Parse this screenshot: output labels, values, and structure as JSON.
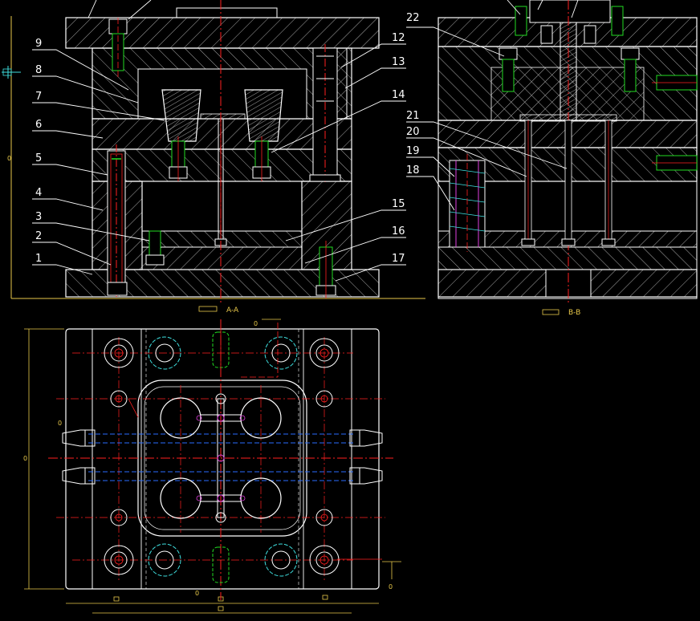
{
  "drawing": {
    "section_aa_caption": "A-A",
    "section_bb_caption": "B-B",
    "dimension_placeholder": "0",
    "part_labels_aa": [
      "9",
      "8",
      "7",
      "6",
      "5",
      "4",
      "3",
      "2",
      "1",
      "12",
      "13",
      "14",
      "15",
      "16",
      "17"
    ],
    "part_labels_bb": [
      "22",
      "21",
      "20",
      "19",
      "18"
    ]
  },
  "colors": {
    "background": "#000000",
    "outline": "#ffffff",
    "centerline": "#ff2020",
    "hidden": "#2a6cff",
    "hatch": "#bfbfbf",
    "fastener": "#22dd22",
    "dimension": "#e8c84a",
    "cyan": "#3fe0e0",
    "magenta": "#e040e0"
  }
}
